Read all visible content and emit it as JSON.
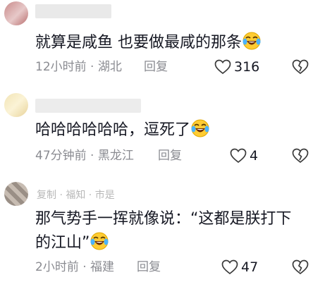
{
  "comments": [
    {
      "text": "就算是咸鱼 也要做最咸的那条",
      "time_location": "12小时前 · 湖北",
      "reply_label": "回复",
      "likes": "316",
      "emoji_icon": "laughing-tears-emoji"
    },
    {
      "text": "哈哈哈哈哈哈，逗死了",
      "time_location": "47分钟前 · 黑龙江",
      "reply_label": "回复",
      "likes": "4",
      "emoji_icon": "laughing-tears-emoji"
    },
    {
      "username": "复制 · 福知 · 市是",
      "text_line1": "那气势手一挥就像说：“这都是朕打下",
      "text_line2": "的江山”",
      "time_location": "2小时前 · 福建",
      "reply_label": "回复",
      "likes": "47",
      "emoji_icon": "laughing-tears-emoji"
    }
  ],
  "colors": {
    "text": "#161823",
    "meta": "#8a8b91",
    "icon_stroke": "#3a3a3a"
  }
}
